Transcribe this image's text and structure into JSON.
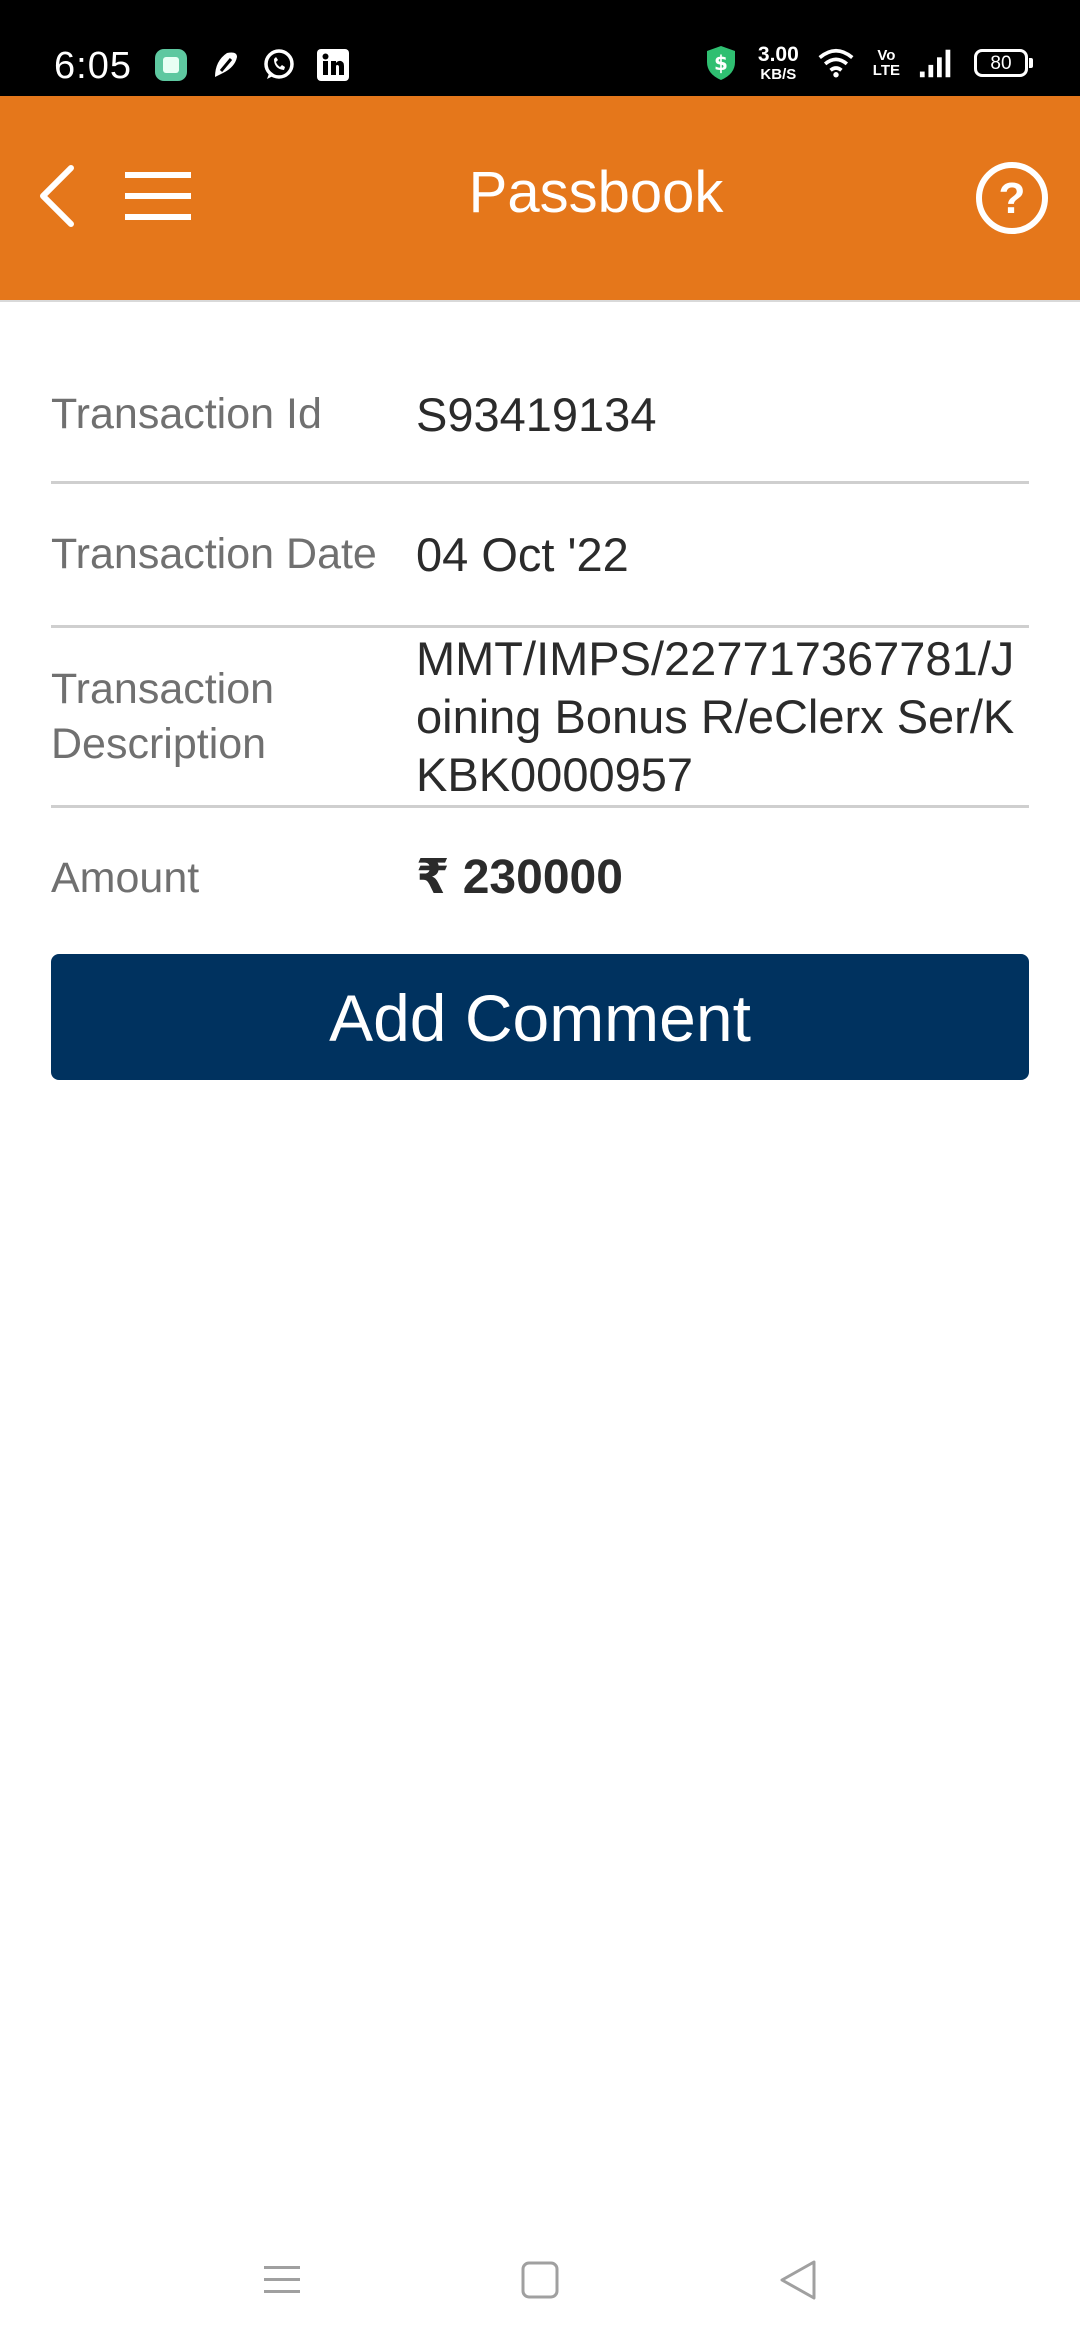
{
  "status_bar": {
    "time": "6:05",
    "net_speed_value": "3.00",
    "net_speed_unit": "KB/S",
    "volte_line1": "Vo",
    "volte_line2": "LTE",
    "battery": "80",
    "left_icons": [
      "app-icon",
      "vpn-icon",
      "whatsapp-icon",
      "linkedin-icon"
    ],
    "right_icons": [
      "security-shield-icon",
      "wifi-icon",
      "signal-icon",
      "battery-icon"
    ]
  },
  "app_bar": {
    "title": "Passbook",
    "background_color": "#e5771b"
  },
  "transaction": {
    "id_label": "Transaction Id",
    "id_value": "S93419134",
    "date_label": "Transaction Date",
    "date_value": "04 Oct '22",
    "description_label": "Transaction Description",
    "description_value": "MMT/IMPS/227717367781/Joining Bonus R/eClerx Ser/KKBK0000957",
    "amount_label": "Amount",
    "amount_value": "₹ 230000"
  },
  "actions": {
    "add_comment_label": "Add Comment",
    "button_color": "#00325f"
  },
  "navigation": {
    "icons": [
      "recent-apps-icon",
      "home-icon",
      "back-nav-icon"
    ]
  }
}
